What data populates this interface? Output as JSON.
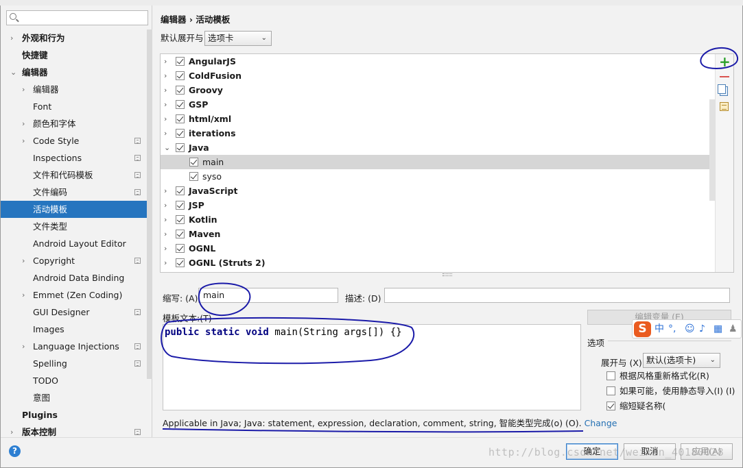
{
  "search": {
    "placeholder": ""
  },
  "sidebar": {
    "items": [
      {
        "label": "外观和行为",
        "arrow": "›",
        "bold": true
      },
      {
        "label": "快捷键",
        "bold": true
      },
      {
        "label": "编辑器",
        "arrow": "⌄",
        "bold": true
      },
      {
        "label": "编辑器",
        "arrow": "›"
      },
      {
        "label": "Font"
      },
      {
        "label": "颜色和字体",
        "arrow": "›"
      },
      {
        "label": "Code Style",
        "arrow": "›",
        "copy": true
      },
      {
        "label": "Inspections",
        "copy": true
      },
      {
        "label": "文件和代码模板",
        "copy": true
      },
      {
        "label": "文件编码",
        "copy": true
      },
      {
        "label": "活动模板",
        "selected": true
      },
      {
        "label": "文件类型"
      },
      {
        "label": "Android Layout Editor"
      },
      {
        "label": "Copyright",
        "arrow": "›",
        "copy": true
      },
      {
        "label": "Android Data Binding"
      },
      {
        "label": "Emmet (Zen Coding)",
        "arrow": "›"
      },
      {
        "label": "GUI Designer",
        "copy": true
      },
      {
        "label": "Images"
      },
      {
        "label": "Language Injections",
        "arrow": "›",
        "copy": true
      },
      {
        "label": "Spelling",
        "copy": true
      },
      {
        "label": "TODO"
      },
      {
        "label": "意图"
      },
      {
        "label": "Plugins",
        "bold": true
      },
      {
        "label": "版本控制",
        "arrow": "›",
        "bold": true,
        "copy": true
      }
    ]
  },
  "main": {
    "breadcrumb": "编辑器 › 活动模板",
    "expand_label": "默认展开与",
    "expand_value": "选项卡",
    "templates": [
      {
        "name": "AngularJS",
        "group": true,
        "expanded": false
      },
      {
        "name": "ColdFusion",
        "group": true,
        "expanded": false
      },
      {
        "name": "Groovy",
        "group": true,
        "expanded": false
      },
      {
        "name": "GSP",
        "group": true,
        "expanded": false
      },
      {
        "name": "html/xml",
        "group": true,
        "expanded": false
      },
      {
        "name": "iterations",
        "group": true,
        "expanded": false
      },
      {
        "name": "Java",
        "group": true,
        "expanded": true
      },
      {
        "name": "main",
        "group": false,
        "selected": true
      },
      {
        "name": "syso",
        "group": false
      },
      {
        "name": "JavaScript",
        "group": true,
        "expanded": false
      },
      {
        "name": "JSP",
        "group": true,
        "expanded": false
      },
      {
        "name": "Kotlin",
        "group": true,
        "expanded": false
      },
      {
        "name": "Maven",
        "group": true,
        "expanded": false
      },
      {
        "name": "OGNL",
        "group": true,
        "expanded": false
      },
      {
        "name": "OGNL (Struts 2)",
        "group": true,
        "expanded": false
      }
    ],
    "abbrev_label": "缩写: (A)",
    "abbrev_value": "main",
    "desc_label": "描述: (D)",
    "desc_value": "",
    "template_text_label": "模板文本:(T)",
    "template_text": {
      "kw1": "public",
      "kw2": "static",
      "kw3": "void",
      "rest": "main(String args[]) {}"
    },
    "edit_vars": "编辑变量 (E)",
    "options_title": "选项",
    "expand_with_label": "展开与 (X)",
    "expand_with_value": "默认(选项卡)",
    "opt_reformat": "根据风格重新格式化(R)",
    "opt_static_import": "如果可能，使用静态导入(I) (I)",
    "opt_shorten": "缩短疑名称(",
    "applicable_text": "Applicable in Java; Java: statement, expression, declaration, comment, string, 智能类型完成(o) (O).",
    "applicable_link": "Change"
  },
  "footer": {
    "help": "?",
    "ok": "确定",
    "cancel": "取消",
    "apply": "应用(A)"
  },
  "ime": {
    "logo": "S",
    "lang": "中"
  },
  "watermark": "http://blog.csdn.net/weixin_40180028",
  "colors": {
    "selection": "#2675bf",
    "annotation": "#1a1aa8",
    "add": "#2ba02b",
    "remove": "#d9534f",
    "link": "#2470b3"
  }
}
